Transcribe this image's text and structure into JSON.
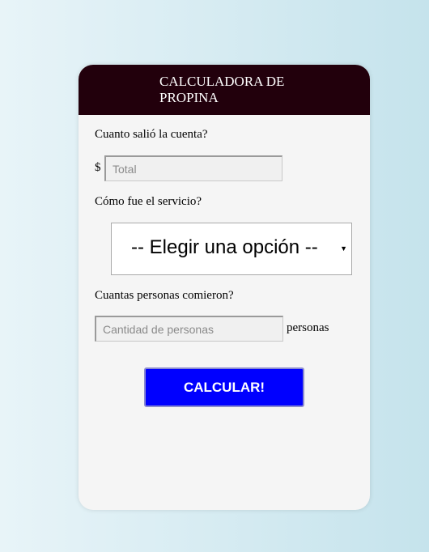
{
  "header": {
    "title": "CALCULADORA DE PROPINA"
  },
  "bill": {
    "label": "Cuanto salió la cuenta?",
    "currency": "$",
    "placeholder": "Total",
    "value": ""
  },
  "service": {
    "label": "Cómo fue el servicio?",
    "selected": "-- Elegir una opción --"
  },
  "people": {
    "label": "Cuantas personas comieron?",
    "placeholder": "Cantidad de personas",
    "value": "",
    "suffix": "personas"
  },
  "actions": {
    "calculate_label": "CALCULAR!"
  },
  "colors": {
    "header_bg": "#22000c",
    "button_bg": "#0000ff",
    "card_bg": "#f5f5f5"
  },
  "icons": {
    "select_caret": "chevron-down-icon"
  }
}
